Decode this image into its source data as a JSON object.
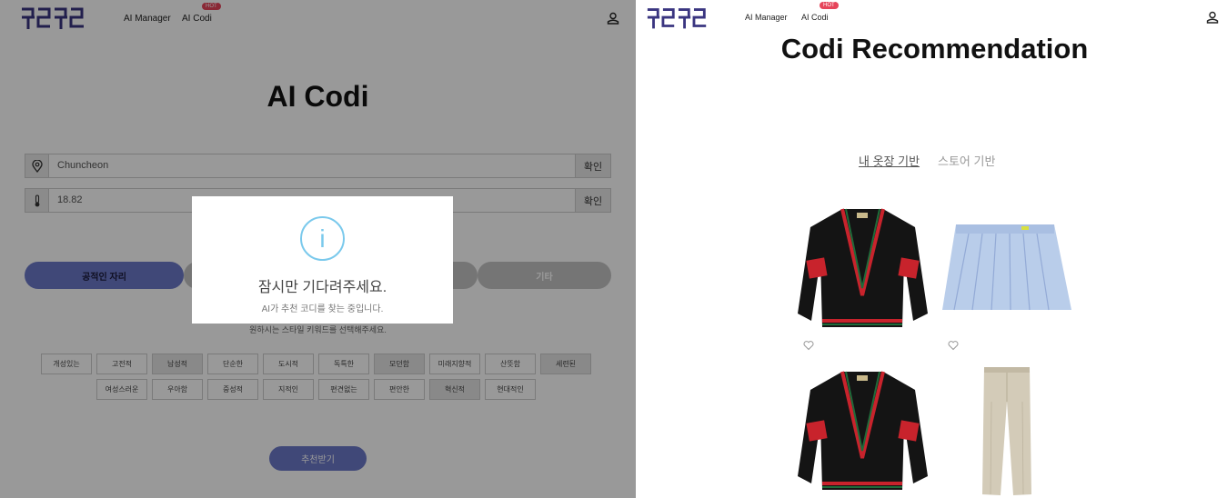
{
  "left": {
    "logo_text": "쿠르쿠르",
    "nav": {
      "ai_manager": "AI Manager",
      "ai_codi": "AI Codi",
      "hot": "HOT"
    },
    "title": "AI Codi",
    "location": {
      "value": "Chuncheon",
      "confirm": "확인"
    },
    "temperature": {
      "value": "18.82",
      "confirm": "확인"
    },
    "occasions": [
      {
        "label": "공적인 자리",
        "state": "selected"
      },
      {
        "label": "",
        "state": "normal"
      },
      {
        "label": "",
        "state": "normal"
      },
      {
        "label": "기타",
        "state": "normal"
      }
    ],
    "hint": "원하시는 스타일 키워드를 선택해주세요.",
    "keywords_row1": [
      "개성있는",
      "고전적",
      "남성적",
      "단순한",
      "도시적",
      "독특한",
      "모던함",
      "미래지향적",
      "산뜻함",
      "세련된"
    ],
    "keywords_row2": [
      "여성스러운",
      "우아함",
      "중성적",
      "지적인",
      "편견없는",
      "편안한",
      "혁신적",
      "현대적인"
    ],
    "recommend_button": "추천받기",
    "modal": {
      "icon": "info-icon",
      "title": "잠시만 기다려주세요.",
      "subtitle": "AI가 추천 코디를 찾는 중입니다."
    }
  },
  "right": {
    "logo_text": "쿠르쿠르",
    "nav": {
      "ai_manager": "AI Manager",
      "ai_codi": "AI Codi",
      "hot": "HOT"
    },
    "title": "Codi Recommendation",
    "tabs": [
      {
        "label": "내 옷장 기반",
        "active": true
      },
      {
        "label": "스토어 기반",
        "active": false
      }
    ],
    "items": [
      {
        "type": "cardigan",
        "colors": [
          "#111111",
          "#c8232c",
          "#1f6b3a"
        ]
      },
      {
        "type": "pleated-skirt",
        "colors": [
          "#b9cdea"
        ]
      },
      {
        "type": "cardigan",
        "colors": [
          "#111111",
          "#c8232c",
          "#1f6b3a"
        ]
      },
      {
        "type": "chino-pants",
        "colors": [
          "#d3cbb8"
        ]
      }
    ]
  },
  "colors": {
    "accent": "#6b78c8",
    "brand_logo": "#3a3580",
    "hot": "#e6455a",
    "info": "#7ac9ec"
  }
}
